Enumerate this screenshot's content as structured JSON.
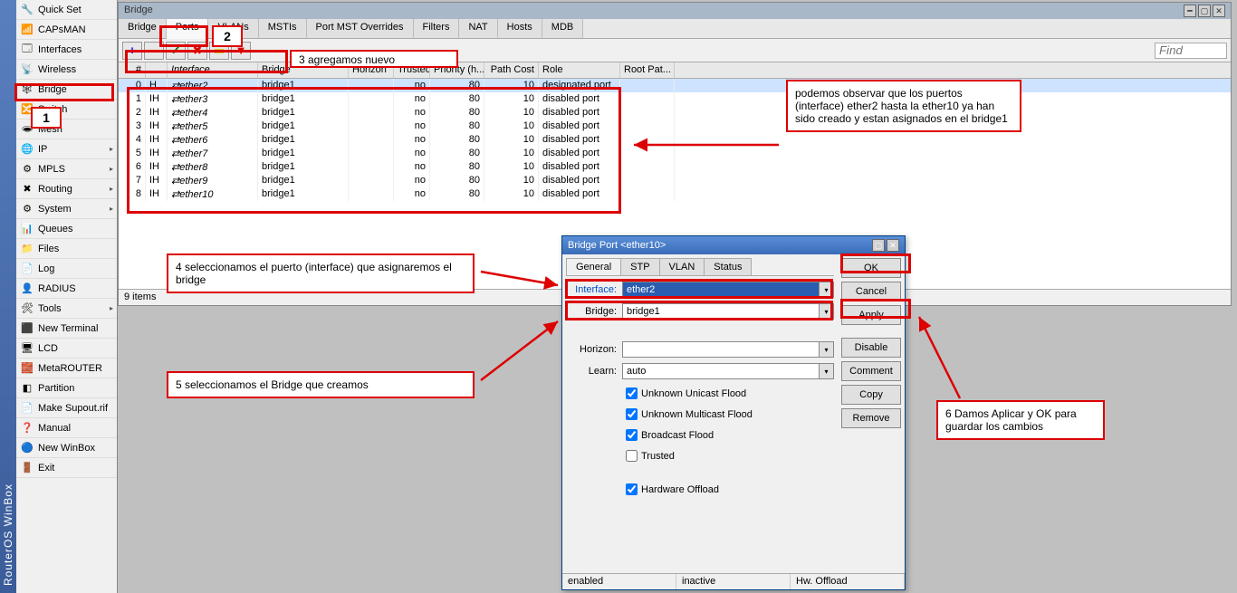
{
  "app_title": "RouterOS WinBox",
  "sidebar": {
    "items": [
      {
        "icon": "🔧",
        "label": "Quick Set",
        "sub": false
      },
      {
        "icon": "📶",
        "label": "CAPsMAN",
        "sub": false
      },
      {
        "icon": "🗔",
        "label": "Interfaces",
        "sub": false
      },
      {
        "icon": "📡",
        "label": "Wireless",
        "sub": false
      },
      {
        "icon": "🕸",
        "label": "Bridge",
        "sub": false,
        "selected": true
      },
      {
        "icon": "🔀",
        "label": "Switch",
        "sub": false
      },
      {
        "icon": "🕳",
        "label": "Mesh",
        "sub": false
      },
      {
        "icon": "🌐",
        "label": "IP",
        "sub": true
      },
      {
        "icon": "⚙",
        "label": "MPLS",
        "sub": true
      },
      {
        "icon": "✖",
        "label": "Routing",
        "sub": true
      },
      {
        "icon": "⚙",
        "label": "System",
        "sub": true
      },
      {
        "icon": "📊",
        "label": "Queues",
        "sub": false
      },
      {
        "icon": "📁",
        "label": "Files",
        "sub": false
      },
      {
        "icon": "📄",
        "label": "Log",
        "sub": false
      },
      {
        "icon": "👤",
        "label": "RADIUS",
        "sub": false
      },
      {
        "icon": "🛠",
        "label": "Tools",
        "sub": true
      },
      {
        "icon": "⬛",
        "label": "New Terminal",
        "sub": false
      },
      {
        "icon": "🖥",
        "label": "LCD",
        "sub": false
      },
      {
        "icon": "🧱",
        "label": "MetaROUTER",
        "sub": false
      },
      {
        "icon": "◧",
        "label": "Partition",
        "sub": false
      },
      {
        "icon": "📄",
        "label": "Make Supout.rif",
        "sub": false
      },
      {
        "icon": "❓",
        "label": "Manual",
        "sub": false
      },
      {
        "icon": "🔵",
        "label": "New WinBox",
        "sub": false
      },
      {
        "icon": "🚪",
        "label": "Exit",
        "sub": false
      }
    ]
  },
  "bridge_window": {
    "title": "Bridge",
    "tabs": [
      "Bridge",
      "Ports",
      "VLANs",
      "MSTIs",
      "Port MST Overrides",
      "Filters",
      "NAT",
      "Hosts",
      "MDB"
    ],
    "active_tab": "Ports",
    "find_placeholder": "Find",
    "columns": [
      "#",
      "",
      "Interface",
      "Bridge",
      "Horizon",
      "Trusted",
      "Priority (h...",
      "Path Cost",
      "Role",
      "Root Pat..."
    ],
    "rows": [
      {
        "n": "0",
        "f": "H",
        "iface": "ether2",
        "bridge": "bridge1",
        "horizon": "",
        "trusted": "no",
        "prio": "80",
        "cost": "10",
        "role": "designated port"
      },
      {
        "n": "1",
        "f": "IH",
        "iface": "ether3",
        "bridge": "bridge1",
        "horizon": "",
        "trusted": "no",
        "prio": "80",
        "cost": "10",
        "role": "disabled port"
      },
      {
        "n": "2",
        "f": "IH",
        "iface": "ether4",
        "bridge": "bridge1",
        "horizon": "",
        "trusted": "no",
        "prio": "80",
        "cost": "10",
        "role": "disabled port"
      },
      {
        "n": "3",
        "f": "IH",
        "iface": "ether5",
        "bridge": "bridge1",
        "horizon": "",
        "trusted": "no",
        "prio": "80",
        "cost": "10",
        "role": "disabled port"
      },
      {
        "n": "4",
        "f": "IH",
        "iface": "ether6",
        "bridge": "bridge1",
        "horizon": "",
        "trusted": "no",
        "prio": "80",
        "cost": "10",
        "role": "disabled port"
      },
      {
        "n": "5",
        "f": "IH",
        "iface": "ether7",
        "bridge": "bridge1",
        "horizon": "",
        "trusted": "no",
        "prio": "80",
        "cost": "10",
        "role": "disabled port"
      },
      {
        "n": "6",
        "f": "IH",
        "iface": "ether8",
        "bridge": "bridge1",
        "horizon": "",
        "trusted": "no",
        "prio": "80",
        "cost": "10",
        "role": "disabled port"
      },
      {
        "n": "7",
        "f": "IH",
        "iface": "ether9",
        "bridge": "bridge1",
        "horizon": "",
        "trusted": "no",
        "prio": "80",
        "cost": "10",
        "role": "disabled port"
      },
      {
        "n": "8",
        "f": "IH",
        "iface": "ether10",
        "bridge": "bridge1",
        "horizon": "",
        "trusted": "no",
        "prio": "80",
        "cost": "10",
        "role": "disabled port"
      }
    ],
    "status": "9 items"
  },
  "dialog": {
    "title": "Bridge Port <ether10>",
    "tabs": [
      "General",
      "STP",
      "VLAN",
      "Status"
    ],
    "active_tab": "General",
    "fields": {
      "interface_label": "Interface:",
      "interface_value": "ether2",
      "bridge_label": "Bridge:",
      "bridge_value": "bridge1",
      "horizon_label": "Horizon:",
      "horizon_value": "",
      "learn_label": "Learn:",
      "learn_value": "auto"
    },
    "checks": {
      "uuf": {
        "label": "Unknown Unicast Flood",
        "checked": true
      },
      "umf": {
        "label": "Unknown Multicast Flood",
        "checked": true
      },
      "bf": {
        "label": "Broadcast Flood",
        "checked": true
      },
      "trusted": {
        "label": "Trusted",
        "checked": false
      },
      "hw": {
        "label": "Hardware Offload",
        "checked": true
      }
    },
    "buttons": {
      "ok": "OK",
      "cancel": "Cancel",
      "apply": "Apply",
      "disable": "Disable",
      "comment": "Comment",
      "copy": "Copy",
      "remove": "Remove"
    },
    "status": {
      "s1": "enabled",
      "s2": "inactive",
      "s3": "Hw. Offload"
    }
  },
  "annotations": {
    "n1": "1",
    "n2": "2",
    "a3": "3 agregamos nuevo",
    "a4": "4 seleccionamos el puerto (interface) que asignaremos el bridge",
    "a5": "5 seleccionamos el Bridge que creamos",
    "a6": "6 Damos Aplicar y OK para guardar los cambios",
    "note": "podemos observar que los puertos (interface) ether2 hasta la ether10 ya han sido creado y estan asignados en el bridge1"
  }
}
